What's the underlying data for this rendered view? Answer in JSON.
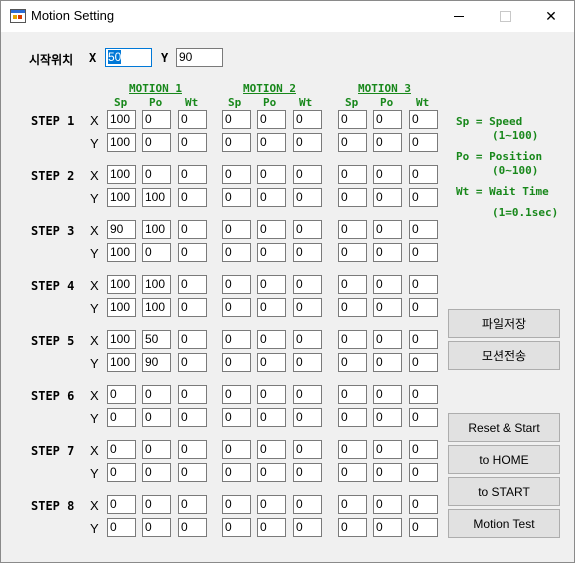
{
  "window": {
    "title": "Motion Setting",
    "min_glyph": "—",
    "max_glyph": "☐",
    "close_glyph": "✕"
  },
  "start_position": {
    "label": "시작위치",
    "x_label": "X",
    "x_value": "50",
    "y_label": "Y",
    "y_value": "90"
  },
  "motions": [
    {
      "title": "MOTION 1",
      "cols": [
        "Sp",
        "Po",
        "Wt"
      ]
    },
    {
      "title": "MOTION 2",
      "cols": [
        "Sp",
        "Po",
        "Wt"
      ]
    },
    {
      "title": "MOTION 3",
      "cols": [
        "Sp",
        "Po",
        "Wt"
      ]
    }
  ],
  "steps": [
    {
      "label": "STEP 1",
      "x": [
        [
          "100",
          "0",
          "0"
        ],
        [
          "0",
          "0",
          "0"
        ],
        [
          "0",
          "0",
          "0"
        ]
      ],
      "y": [
        [
          "100",
          "0",
          "0"
        ],
        [
          "0",
          "0",
          "0"
        ],
        [
          "0",
          "0",
          "0"
        ]
      ]
    },
    {
      "label": "STEP 2",
      "x": [
        [
          "100",
          "0",
          "0"
        ],
        [
          "0",
          "0",
          "0"
        ],
        [
          "0",
          "0",
          "0"
        ]
      ],
      "y": [
        [
          "100",
          "100",
          "0"
        ],
        [
          "0",
          "0",
          "0"
        ],
        [
          "0",
          "0",
          "0"
        ]
      ]
    },
    {
      "label": "STEP 3",
      "x": [
        [
          "90",
          "100",
          "0"
        ],
        [
          "0",
          "0",
          "0"
        ],
        [
          "0",
          "0",
          "0"
        ]
      ],
      "y": [
        [
          "100",
          "0",
          "0"
        ],
        [
          "0",
          "0",
          "0"
        ],
        [
          "0",
          "0",
          "0"
        ]
      ]
    },
    {
      "label": "STEP 4",
      "x": [
        [
          "100",
          "100",
          "0"
        ],
        [
          "0",
          "0",
          "0"
        ],
        [
          "0",
          "0",
          "0"
        ]
      ],
      "y": [
        [
          "100",
          "100",
          "0"
        ],
        [
          "0",
          "0",
          "0"
        ],
        [
          "0",
          "0",
          "0"
        ]
      ]
    },
    {
      "label": "STEP 5",
      "x": [
        [
          "100",
          "50",
          "0"
        ],
        [
          "0",
          "0",
          "0"
        ],
        [
          "0",
          "0",
          "0"
        ]
      ],
      "y": [
        [
          "100",
          "90",
          "0"
        ],
        [
          "0",
          "0",
          "0"
        ],
        [
          "0",
          "0",
          "0"
        ]
      ]
    },
    {
      "label": "STEP 6",
      "x": [
        [
          "0",
          "0",
          "0"
        ],
        [
          "0",
          "0",
          "0"
        ],
        [
          "0",
          "0",
          "0"
        ]
      ],
      "y": [
        [
          "0",
          "0",
          "0"
        ],
        [
          "0",
          "0",
          "0"
        ],
        [
          "0",
          "0",
          "0"
        ]
      ]
    },
    {
      "label": "STEP 7",
      "x": [
        [
          "0",
          "0",
          "0"
        ],
        [
          "0",
          "0",
          "0"
        ],
        [
          "0",
          "0",
          "0"
        ]
      ],
      "y": [
        [
          "0",
          "0",
          "0"
        ],
        [
          "0",
          "0",
          "0"
        ],
        [
          "0",
          "0",
          "0"
        ]
      ]
    },
    {
      "label": "STEP 8",
      "x": [
        [
          "0",
          "0",
          "0"
        ],
        [
          "0",
          "0",
          "0"
        ],
        [
          "0",
          "0",
          "0"
        ]
      ],
      "y": [
        [
          "0",
          "0",
          "0"
        ],
        [
          "0",
          "0",
          "0"
        ],
        [
          "0",
          "0",
          "0"
        ]
      ]
    }
  ],
  "axis_labels": {
    "x": "X",
    "y": "Y"
  },
  "legend": [
    "Sp = Speed",
    "(1~100)",
    "Po = Position",
    "(0~100)",
    "Wt = Wait Time",
    "(1=0.1sec)"
  ],
  "buttons": {
    "save_file": "파일저장",
    "send_motion": "모션전송",
    "reset_start": "Reset & Start",
    "to_home": "to HOME",
    "to_start": "to START",
    "motion_test": "Motion Test"
  },
  "colors": {
    "accent_green": "#18881b",
    "selection_blue": "#0078d7"
  }
}
